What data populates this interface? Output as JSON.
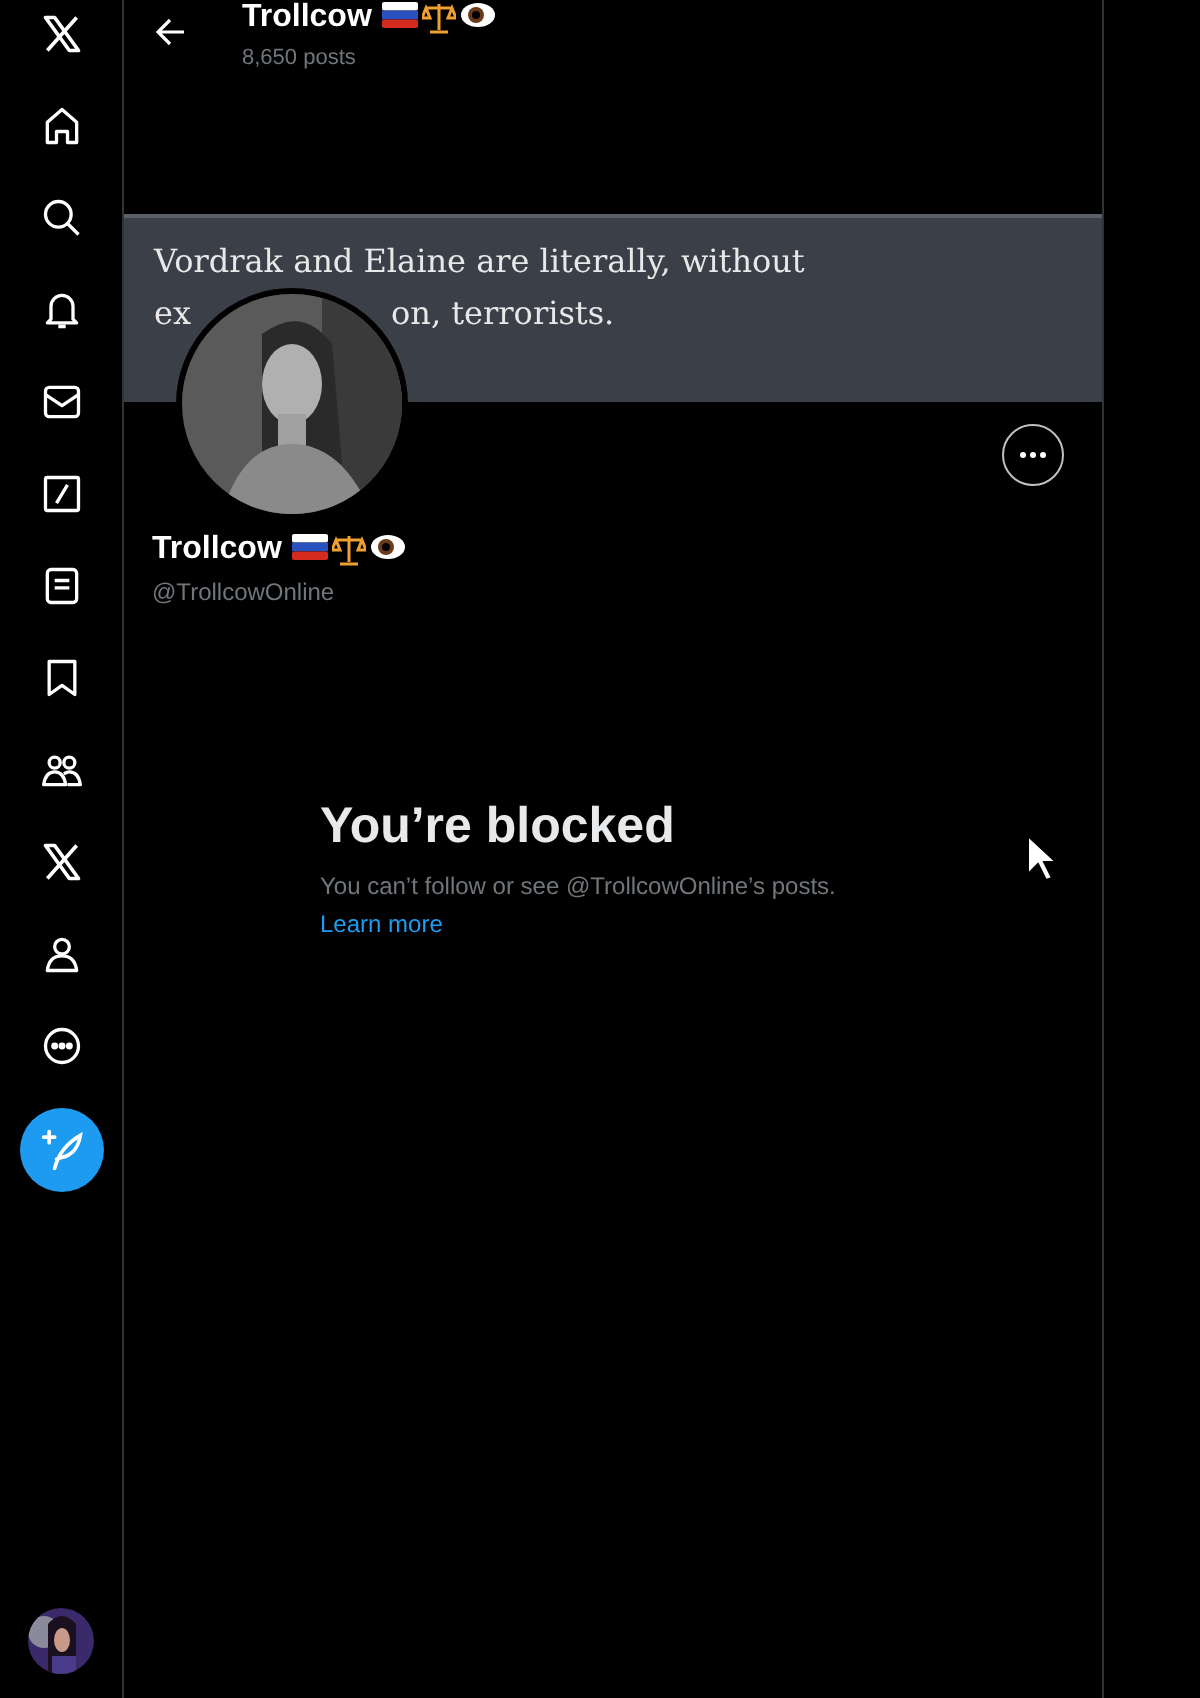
{
  "nav": [
    {
      "kind": "logo"
    },
    {
      "kind": "home"
    },
    {
      "kind": "search"
    },
    {
      "kind": "bell"
    },
    {
      "kind": "mail"
    },
    {
      "kind": "slash"
    },
    {
      "kind": "list"
    },
    {
      "kind": "bookmark"
    },
    {
      "kind": "people"
    },
    {
      "kind": "logo"
    },
    {
      "kind": "person"
    },
    {
      "kind": "more"
    }
  ],
  "header": {
    "name": "Trollcow",
    "posts": "8,650 posts"
  },
  "banner": {
    "line_1": "Vordrak and Elaine are literally, without",
    "line_2_start": "ex",
    "line_2_end": "on, terrorists."
  },
  "profile": {
    "name": "Trollcow",
    "handle": "@TrollcowOnline"
  },
  "blocked": {
    "title": "You’re blocked",
    "message": "You can’t follow or see @TrollcowOnline’s posts.",
    "link": "Learn more"
  }
}
